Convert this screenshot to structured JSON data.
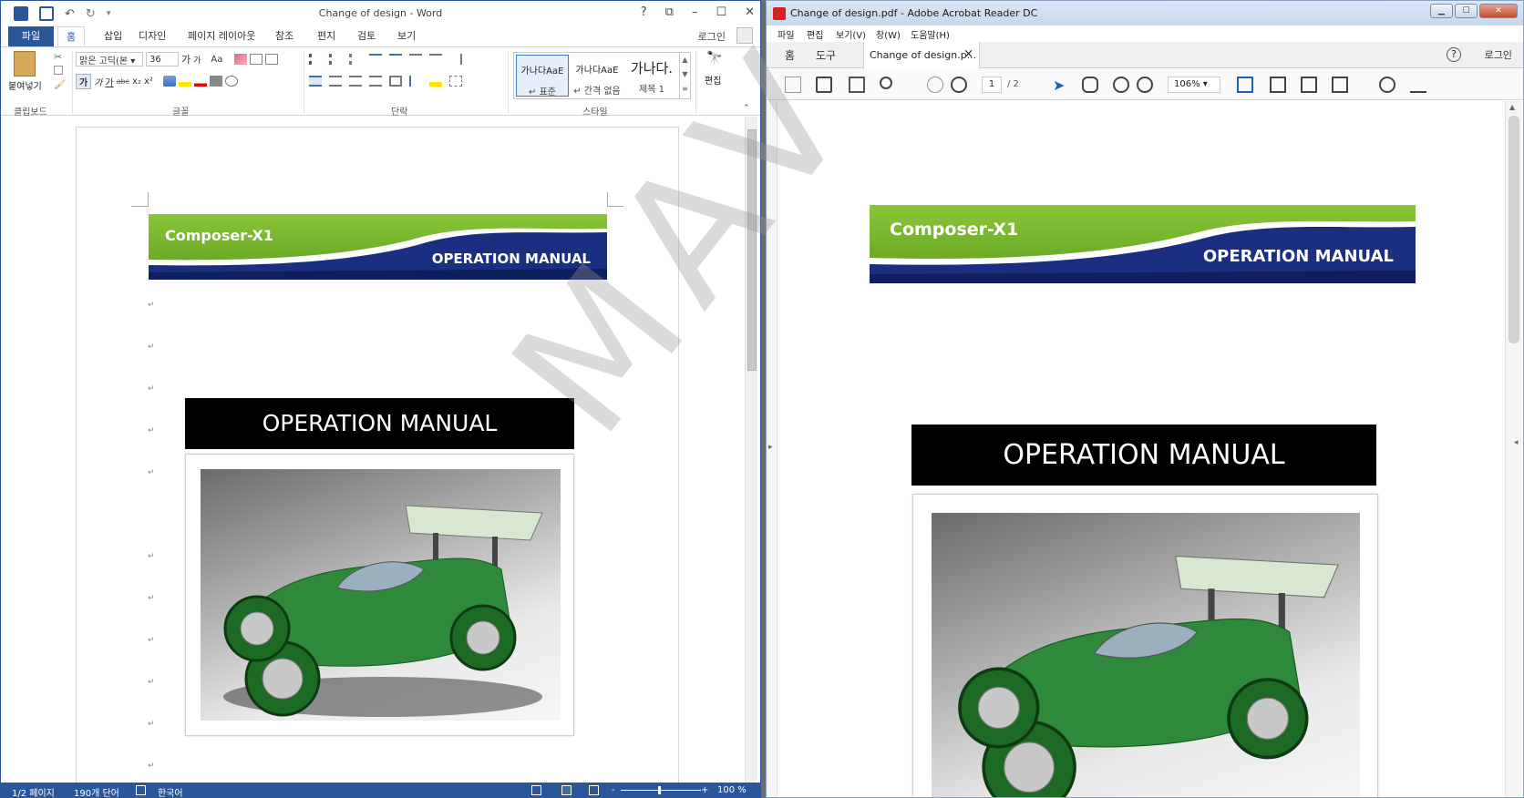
{
  "word": {
    "title": "Change of design - Word",
    "help": "?",
    "controls": {
      "ribbon_opts": "⧉",
      "minimize": "–",
      "restore": "☐",
      "close": "✕"
    },
    "tabs": {
      "file": "파일",
      "home": "홈",
      "insert": "삽입",
      "design": "디자인",
      "layout": "페이지 레이아웃",
      "references": "참조",
      "mailings": "편지",
      "review": "검토",
      "view": "보기"
    },
    "login": "로그인",
    "ribbon": {
      "paste": "붙여넣기",
      "font_name": "맑은 고딕(본 ▾",
      "font_size": "36",
      "grow": "가",
      "shrink": "가",
      "change_case": "Aa",
      "bold": "가",
      "italic": "가",
      "underline": "가",
      "strike": "abc",
      "subscript": "x₂",
      "superscript": "x²",
      "styles": [
        {
          "sample": "가나다AaE",
          "name": "↵ 표준"
        },
        {
          "sample": "가나다AaE",
          "name": "↵ 간격 없음"
        },
        {
          "sample": "가나다.",
          "name": "제목 1"
        }
      ],
      "edit": "편집",
      "groups": {
        "clipboard": "클립보드",
        "font": "글꼴",
        "paragraph": "단락",
        "styles": "스타일"
      }
    },
    "document": {
      "banner_title": "Composer-X1",
      "banner_subtitle": "OPERATION MANUAL",
      "op_title": "OPERATION MANUAL",
      "para_mark": "↵"
    },
    "status": {
      "page": "1/2 페이지",
      "words": "190개 단어",
      "lang": "한국어",
      "zoom": "100 %",
      "zoom_minus": "-",
      "zoom_plus": "+"
    }
  },
  "watermark": "MAV",
  "acrobat": {
    "title": "Change of design.pdf - Adobe Acrobat Reader DC",
    "menu": [
      "파일",
      "편집",
      "보기(V)",
      "창(W)",
      "도움말(H)"
    ],
    "tabs": {
      "home": "홈",
      "tools": "도구",
      "doc": "Change of design.p...",
      "close": "×"
    },
    "help": "?",
    "login": "로그인",
    "toolbar": {
      "page_current": "1",
      "page_total": "/ 2",
      "zoom": "106%"
    },
    "document": {
      "banner_title": "Composer-X1",
      "banner_subtitle": "OPERATION MANUAL",
      "op_title": "OPERATION MANUAL"
    }
  },
  "colors": {
    "word_blue": "#2b579a",
    "banner_green": "#7cbf30",
    "banner_navy": "#1b2f80"
  }
}
